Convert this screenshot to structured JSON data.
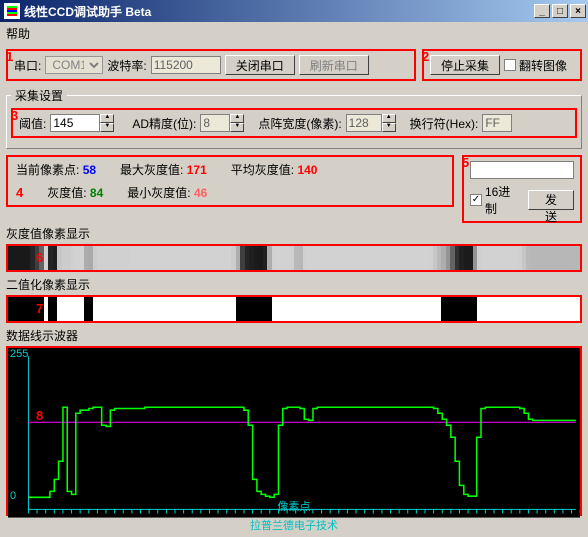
{
  "window": {
    "title": "线性CCD调试助手 Beta"
  },
  "menu": {
    "help": "帮助"
  },
  "toolbar": {
    "port_label": "串口:",
    "port_value": "COM1",
    "baud_label": "波特率:",
    "baud_value": "115200",
    "close_port": "关闭串口",
    "refresh_port": "刷新串口",
    "stop_capture": "停止采集",
    "flip_image": "翻转图像"
  },
  "capture_group": {
    "legend": "采集设置",
    "threshold_label": "阈值:",
    "threshold_value": "145",
    "ad_label": "AD精度(位):",
    "ad_value": "8",
    "dot_label": "点阵宽度(像素):",
    "dot_value": "128",
    "newline_label": "换行符(Hex):",
    "newline_value": "FF"
  },
  "stats": {
    "cur_pixel_label": "当前像素点:",
    "cur_pixel_value": "58",
    "max_gray_label": "最大灰度值:",
    "max_gray_value": "171",
    "avg_gray_label": "平均灰度值:",
    "avg_gray_value": "140",
    "gray_label": "灰度值:",
    "gray_value": "84",
    "min_gray_label": "最小灰度值:",
    "min_gray_value": "46"
  },
  "send": {
    "hex_label": "16进制",
    "send_btn": "发送"
  },
  "labels": {
    "gray_display": "灰度值像素显示",
    "binary_display": "二值化像素显示",
    "oscilloscope": "数据线示波器",
    "x_axis": "像素点",
    "footer": "拉普兰德电子技术"
  },
  "annotations": {
    "n1": "1",
    "n2": "2",
    "n3": "3",
    "n4": "4",
    "n5": "5",
    "n6": "6",
    "n7": "7",
    "n8": "8"
  },
  "chart_data": {
    "type": "line",
    "title": "数据线示波器",
    "xlabel": "像素点",
    "ylabel": "",
    "xlim": [
      0,
      128
    ],
    "ylim": [
      0,
      255
    ],
    "threshold_line": 145,
    "values": [
      20,
      20,
      20,
      20,
      20,
      30,
      50,
      80,
      170,
      30,
      25,
      160,
      165,
      165,
      168,
      170,
      170,
      140,
      138,
      165,
      168,
      168,
      168,
      168,
      168,
      168,
      168,
      170,
      170,
      170,
      170,
      170,
      170,
      170,
      170,
      170,
      170,
      170,
      170,
      170,
      170,
      170,
      170,
      170,
      170,
      170,
      170,
      170,
      170,
      170,
      165,
      140,
      50,
      30,
      25,
      22,
      20,
      25,
      140,
      168,
      170,
      170,
      170,
      168,
      150,
      148,
      168,
      170,
      170,
      170,
      170,
      170,
      170,
      170,
      170,
      170,
      170,
      170,
      170,
      170,
      170,
      170,
      170,
      170,
      170,
      170,
      170,
      170,
      170,
      170,
      170,
      170,
      170,
      170,
      168,
      160,
      150,
      140,
      120,
      80,
      40,
      25,
      22,
      22,
      120,
      168,
      170,
      170,
      170,
      170,
      170,
      170,
      170,
      170,
      168,
      160,
      150,
      148,
      148,
      148,
      148,
      148,
      148,
      148,
      148,
      148,
      148,
      148
    ]
  },
  "binary_data": [
    0,
    0,
    0,
    0,
    0,
    0,
    0,
    0,
    1,
    0,
    0,
    1,
    1,
    1,
    1,
    1,
    1,
    0,
    0,
    1,
    1,
    1,
    1,
    1,
    1,
    1,
    1,
    1,
    1,
    1,
    1,
    1,
    1,
    1,
    1,
    1,
    1,
    1,
    1,
    1,
    1,
    1,
    1,
    1,
    1,
    1,
    1,
    1,
    1,
    1,
    1,
    0,
    0,
    0,
    0,
    0,
    0,
    0,
    0,
    1,
    1,
    1,
    1,
    1,
    1,
    1,
    1,
    1,
    1,
    1,
    1,
    1,
    1,
    1,
    1,
    1,
    1,
    1,
    1,
    1,
    1,
    1,
    1,
    1,
    1,
    1,
    1,
    1,
    1,
    1,
    1,
    1,
    1,
    1,
    1,
    1,
    1,
    0,
    0,
    0,
    0,
    0,
    0,
    0,
    0,
    1,
    1,
    1,
    1,
    1,
    1,
    1,
    1,
    1,
    1,
    1,
    1,
    1,
    1,
    1,
    1,
    1,
    1,
    1,
    1,
    1,
    1,
    1
  ]
}
